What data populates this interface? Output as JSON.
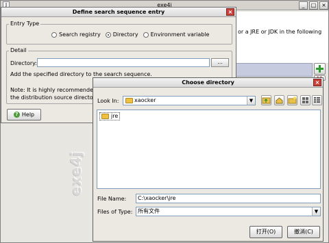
{
  "main": {
    "title": "exe4j",
    "sys_icon": "J",
    "minimize": "_",
    "maximize": "□",
    "close": "×",
    "description": "or a JRE or JDK in the following",
    "logo": "exe4j"
  },
  "define_dialog": {
    "title": "Define search sequence entry",
    "entry_type_label": "Entry Type",
    "options": [
      "Search registry",
      "Directory",
      "Environment variable"
    ],
    "selected": "Directory",
    "detail_label": "Detail",
    "directory_label": "Directory:",
    "directory_value": "",
    "browse_label": "...",
    "hint": "Add the specified directory to the search sequence.",
    "note_line1": "Note: It is highly recommended to en",
    "note_line2": "the distribution source directory.",
    "help_label": "Help"
  },
  "choose_dialog": {
    "title": "Choose directory",
    "look_in_label": "Look In:",
    "look_in_value": "xaocker",
    "items": [
      "jre"
    ],
    "file_name_label": "File Name:",
    "file_name_value": "C:\\xaocker\\jre",
    "files_of_type_label": "Files of Type:",
    "files_of_type_value": "所有文件",
    "open_label": "打开(O)",
    "cancel_label": "撤消(C)"
  }
}
